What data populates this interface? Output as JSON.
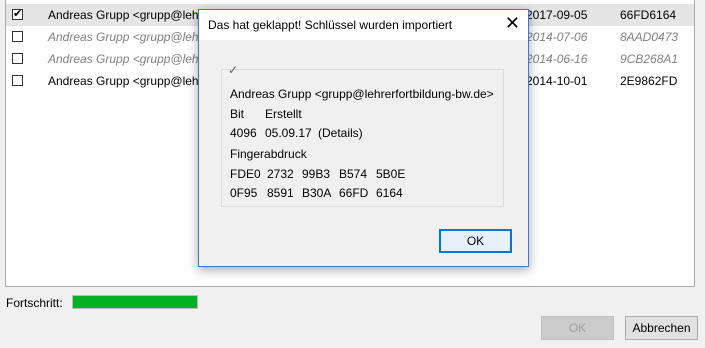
{
  "list": {
    "rows": [
      {
        "checked": true,
        "name": "Andreas Grupp <grupp@lehrerfortbildung-bw.de>",
        "date": "2017-09-05",
        "fingerprint": "66FD6164"
      },
      {
        "checked": false,
        "name": "Andreas Grupp <grupp@lehrerfortbildung-bw.de>",
        "date": "2014-07-06",
        "fingerprint": "8AAD0473"
      },
      {
        "checked": false,
        "name": "Andreas Grupp <grupp@lehrerfortbildung-bw.de>",
        "date": "2014-06-16",
        "fingerprint": "9CB268A1"
      },
      {
        "checked": false,
        "name": "Andreas Grupp <grupp@lehrerfortbildung-bw.de>",
        "date": "2014-10-01",
        "fingerprint": "2E9862FD"
      }
    ]
  },
  "progress": {
    "label": "Fortschritt:",
    "value": 1.0,
    "color": "#06b025"
  },
  "buttons": {
    "ok": "OK",
    "cancel": "Abbrechen"
  },
  "dialog": {
    "title": "Das hat geklappt! Schlüssel wurden importiert",
    "close_icon": "close-icon",
    "identity": "Andreas Grupp <grupp@lehrerfortbildung-bw.de>",
    "bit_label": "Bit",
    "created_label": "Erstellt",
    "bits": "4096",
    "created": "05.09.17",
    "details": "(Details)",
    "fingerprint_label": "Fingerabdruck",
    "fp_line1": [
      "FDE0",
      "2732",
      "99B3",
      "B574",
      "5B0E"
    ],
    "fp_line2": [
      "0F95",
      "8591",
      "B30A",
      "66FD",
      "6164"
    ],
    "ok": "OK"
  }
}
